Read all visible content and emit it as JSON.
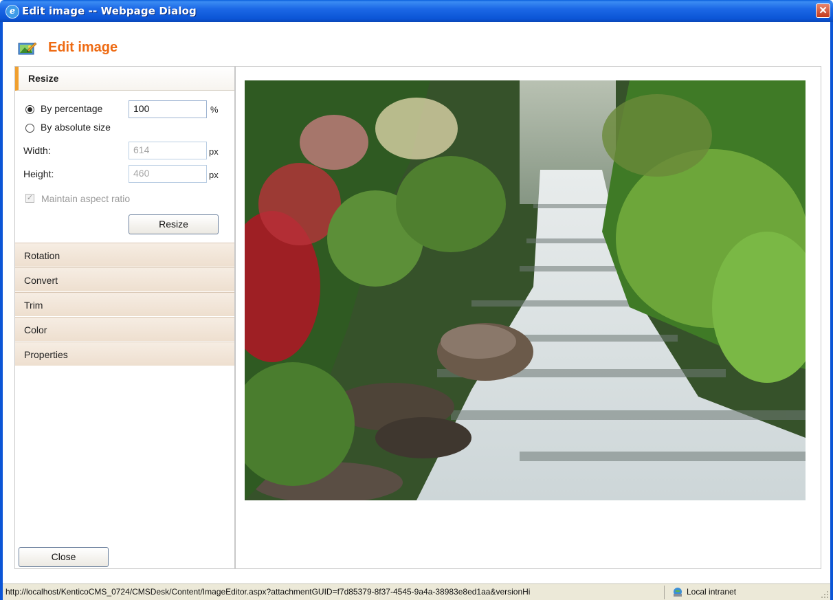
{
  "window": {
    "title": "Edit image -- Webpage Dialog",
    "close_glyph": "✕",
    "ie_glyph": "e"
  },
  "header": {
    "title": "Edit image",
    "accent_color": "#ee6a12"
  },
  "resize_section": {
    "header": "Resize",
    "by_percentage_label": "By percentage",
    "by_percentage_checked": true,
    "percentage_value": "100",
    "percent_unit": "%",
    "by_absolute_label": "By absolute size",
    "width_label": "Width:",
    "width_value": "614",
    "height_label": "Height:",
    "height_value": "460",
    "px_unit": "px",
    "maintain_aspect_label": "Maintain aspect ratio",
    "maintain_aspect_checked": true,
    "resize_button": "Resize"
  },
  "sections": [
    {
      "label": "Rotation"
    },
    {
      "label": "Convert"
    },
    {
      "label": "Trim"
    },
    {
      "label": "Color"
    },
    {
      "label": "Properties"
    }
  ],
  "footer": {
    "close_button": "Close"
  },
  "statusbar": {
    "url": "http://localhost/KenticoCMS_0724/CMSDesk/Content/ImageEditor.aspx?attachmentGUID=f7d85379-8f37-4545-9a4a-38983e8ed1aa&versionHi",
    "zone": "Local intranet"
  }
}
